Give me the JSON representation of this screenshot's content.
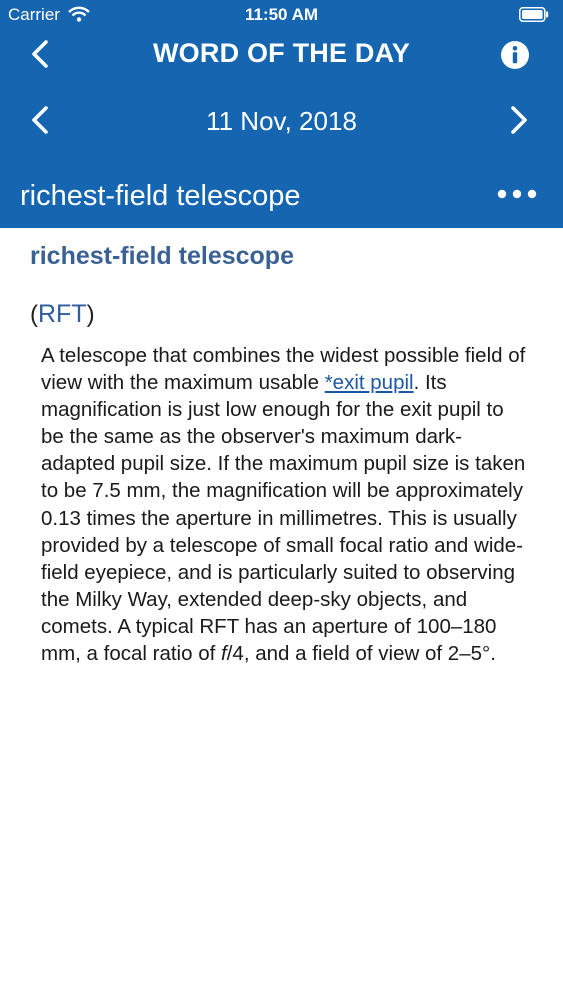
{
  "status_bar": {
    "carrier": "Carrier",
    "time": "11:50 AM"
  },
  "nav": {
    "title": "WORD OF THE DAY"
  },
  "date_bar": {
    "date": "11 Nov, 2018"
  },
  "term_bar": {
    "term": "richest-field telescope"
  },
  "entry": {
    "headword": "richest-field telescope",
    "abbr_open": "(",
    "abbr": "RFT",
    "abbr_close": ")",
    "def_part1": "A telescope that combines the widest possible field of view with the maximum usable ",
    "def_link": "*exit pupil",
    "def_part2": ". Its magnification is just low enough for the exit pupil to be the same as the observer's maximum dark-adapted pupil size. If the maximum pupil size is taken to be 7.5 mm, the magnification will be approximately 0.13 times the aperture in millimetres. This is usually provided by a telescope of small focal ratio and wide-field eyepiece, and is particularly suited to observing the Milky Way, extended deep-sky objects, and comets. A typical RFT has an aperture of 100–180 mm, a focal ratio of ",
    "def_italic": "f",
    "def_part3": "/4, and a field of view of 2–5°."
  },
  "colors": {
    "header_bg": "#1565b0",
    "headword": "#3a6193",
    "link": "#1d58a6"
  },
  "icons": [
    "wifi-icon",
    "battery-icon",
    "back-chevron-icon",
    "info-icon",
    "chevron-left-icon",
    "chevron-right-icon",
    "more-dots-icon"
  ]
}
